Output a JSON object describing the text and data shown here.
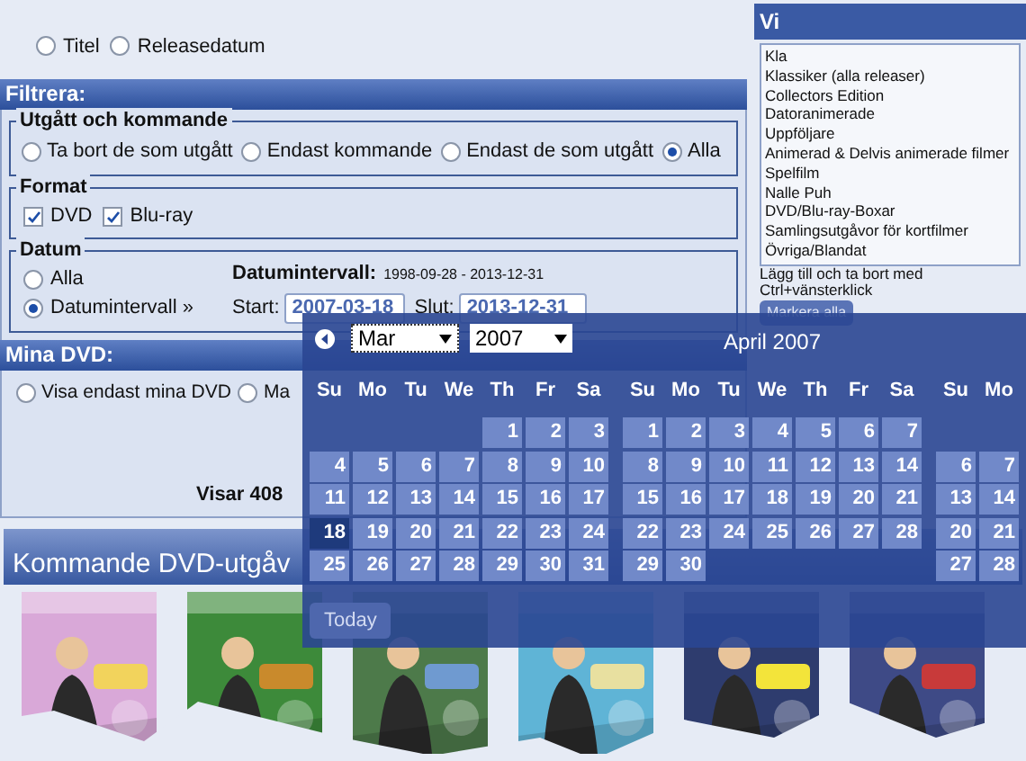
{
  "sort": {
    "options": [
      {
        "label": "Titel",
        "selected": false
      },
      {
        "label": "Releasedatum",
        "selected": false
      }
    ]
  },
  "filter": {
    "title": "Filtrera:",
    "status": {
      "legend": "Utgått och kommande",
      "options": [
        {
          "label": "Ta bort de som utgått",
          "selected": false
        },
        {
          "label": "Endast kommande",
          "selected": false
        },
        {
          "label": "Endast de som utgått",
          "selected": false
        },
        {
          "label": "Alla",
          "selected": true
        }
      ]
    },
    "format": {
      "legend": "Format",
      "options": [
        {
          "label": "DVD",
          "checked": true
        },
        {
          "label": "Blu-ray",
          "checked": true
        }
      ]
    },
    "date": {
      "legend": "Datum",
      "options": [
        {
          "label": "Alla",
          "selected": false
        },
        {
          "label": "Datumintervall »",
          "selected": true
        }
      ],
      "range_label": "Datumintervall:",
      "range_value": "1998-09-28 - 2013-12-31",
      "start_label": "Start:",
      "start_value": "2007-03-18",
      "end_label": "Slut:",
      "end_value": "2013-12-31"
    }
  },
  "my_dvd": {
    "title": "Mina DVD:",
    "options": [
      {
        "label": "Visa endast mina DVD",
        "selected": false
      },
      {
        "label": "Ma",
        "selected": false
      }
    ],
    "count": "Visar 408"
  },
  "categories": {
    "title": "Vi",
    "items": [
      "Kla",
      "Klassiker (alla releaser)",
      "Collectors Edition",
      "Datoranimerade",
      "Uppföljare",
      "Animerad & Delvis animerade filmer",
      "Spelfilm",
      "Nalle Puh",
      "DVD/Blu-ray-Boxar",
      "Samlingsutgåvor för kortfilmer",
      "Övriga/Blandat"
    ],
    "hint": "Lägg till och ta bort med Ctrl+vänsterklick",
    "button": "Markera alla"
  },
  "upcoming": {
    "title": "Kommande DVD-utgåv"
  },
  "calendar": {
    "month_select": "Mar",
    "year_select": "2007",
    "today": "Today",
    "months": [
      {
        "weekdays": [
          "Su",
          "Mo",
          "Tu",
          "We",
          "Th",
          "Fr",
          "Sa"
        ],
        "weeks": [
          {
            "kind": "end",
            "days": [
              {
                "d": "1",
                "selected": false
              },
              {
                "d": "2",
                "selected": false
              },
              {
                "d": "3",
                "selected": false
              }
            ]
          },
          {
            "kind": "full",
            "days": [
              {
                "d": "4",
                "selected": false
              },
              {
                "d": "5",
                "selected": false
              },
              {
                "d": "6",
                "selected": false
              },
              {
                "d": "7",
                "selected": false
              },
              {
                "d": "8",
                "selected": false
              },
              {
                "d": "9",
                "selected": false
              },
              {
                "d": "10",
                "selected": false
              }
            ]
          },
          {
            "kind": "full",
            "days": [
              {
                "d": "11",
                "selected": false
              },
              {
                "d": "12",
                "selected": false
              },
              {
                "d": "13",
                "selected": false
              },
              {
                "d": "14",
                "selected": false
              },
              {
                "d": "15",
                "selected": false
              },
              {
                "d": "16",
                "selected": false
              },
              {
                "d": "17",
                "selected": false
              }
            ]
          },
          {
            "kind": "full",
            "days": [
              {
                "d": "18",
                "selected": true
              },
              {
                "d": "19",
                "selected": false
              },
              {
                "d": "20",
                "selected": false
              },
              {
                "d": "21",
                "selected": false
              },
              {
                "d": "22",
                "selected": false
              },
              {
                "d": "23",
                "selected": false
              },
              {
                "d": "24",
                "selected": false
              }
            ]
          },
          {
            "kind": "full",
            "days": [
              {
                "d": "25",
                "selected": false
              },
              {
                "d": "26",
                "selected": false
              },
              {
                "d": "27",
                "selected": false
              },
              {
                "d": "28",
                "selected": false
              },
              {
                "d": "29",
                "selected": false
              },
              {
                "d": "30",
                "selected": false
              },
              {
                "d": "31",
                "selected": false
              }
            ]
          }
        ]
      },
      {
        "title": "April 2007",
        "weekdays": [
          "Su",
          "Mo",
          "Tu",
          "We",
          "Th",
          "Fr",
          "Sa"
        ],
        "weeks": [
          {
            "kind": "full",
            "days": [
              {
                "d": "1",
                "selected": false
              },
              {
                "d": "2",
                "selected": false
              },
              {
                "d": "3",
                "selected": false
              },
              {
                "d": "4",
                "selected": false
              },
              {
                "d": "5",
                "selected": false
              },
              {
                "d": "6",
                "selected": false
              },
              {
                "d": "7",
                "selected": false
              }
            ]
          },
          {
            "kind": "full",
            "days": [
              {
                "d": "8",
                "selected": false
              },
              {
                "d": "9",
                "selected": false
              },
              {
                "d": "10",
                "selected": false
              },
              {
                "d": "11",
                "selected": false
              },
              {
                "d": "12",
                "selected": false
              },
              {
                "d": "13",
                "selected": false
              },
              {
                "d": "14",
                "selected": false
              }
            ]
          },
          {
            "kind": "full",
            "days": [
              {
                "d": "15",
                "selected": false
              },
              {
                "d": "16",
                "selected": false
              },
              {
                "d": "17",
                "selected": false
              },
              {
                "d": "18",
                "selected": false
              },
              {
                "d": "19",
                "selected": false
              },
              {
                "d": "20",
                "selected": false
              },
              {
                "d": "21",
                "selected": false
              }
            ]
          },
          {
            "kind": "full",
            "days": [
              {
                "d": "22",
                "selected": false
              },
              {
                "d": "23",
                "selected": false
              },
              {
                "d": "24",
                "selected": false
              },
              {
                "d": "25",
                "selected": false
              },
              {
                "d": "26",
                "selected": false
              },
              {
                "d": "27",
                "selected": false
              },
              {
                "d": "28",
                "selected": false
              }
            ]
          },
          {
            "kind": "start",
            "days": [
              {
                "d": "29",
                "selected": false
              },
              {
                "d": "30",
                "selected": false
              }
            ]
          }
        ]
      },
      {
        "weekdays": [
          "Su",
          "Mo"
        ],
        "weeks": [
          {
            "kind": "blank"
          },
          {
            "kind": "full",
            "days": [
              {
                "d": "6",
                "selected": false
              },
              {
                "d": "7",
                "selected": false
              }
            ]
          },
          {
            "kind": "full",
            "days": [
              {
                "d": "13",
                "selected": false
              },
              {
                "d": "14",
                "selected": false
              }
            ]
          },
          {
            "kind": "full",
            "days": [
              {
                "d": "20",
                "selected": false
              },
              {
                "d": "21",
                "selected": false
              }
            ]
          },
          {
            "kind": "full",
            "days": [
              {
                "d": "27",
                "selected": false
              },
              {
                "d": "28",
                "selected": false
              }
            ]
          }
        ]
      }
    ]
  }
}
